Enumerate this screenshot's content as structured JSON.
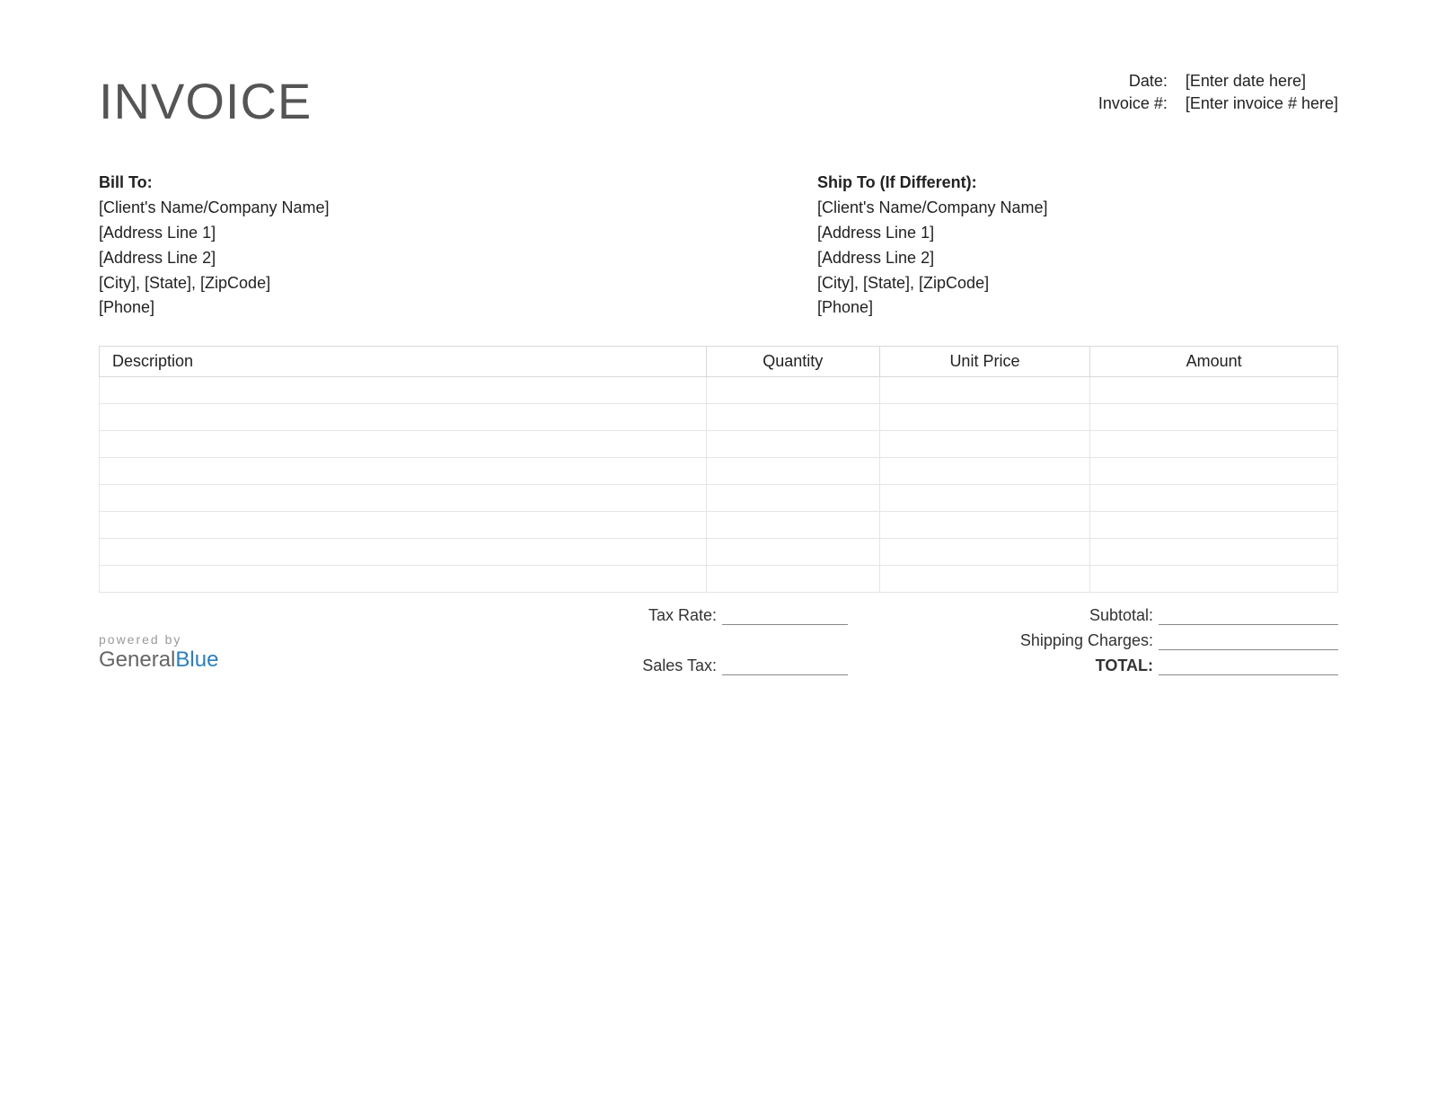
{
  "title": "INVOICE",
  "meta": {
    "date_label": "Date:",
    "date_value": "[Enter date here]",
    "invoice_num_label": "Invoice #:",
    "invoice_num_value": "[Enter invoice # here]"
  },
  "bill_to": {
    "heading": "Bill To:",
    "line1": "[Client's Name/Company Name]",
    "line2": "[Address Line 1]",
    "line3": "[Address Line 2]",
    "line4": "[City], [State], [ZipCode]",
    "line5": "[Phone]"
  },
  "ship_to": {
    "heading": "Ship To (If Different):",
    "line1": "[Client's Name/Company Name]",
    "line2": "[Address Line 1]",
    "line3": "[Address Line 2]",
    "line4": "[City], [State], [ZipCode]",
    "line5": "[Phone]"
  },
  "table": {
    "headers": {
      "description": "Description",
      "quantity": "Quantity",
      "unit_price": "Unit Price",
      "amount": "Amount"
    },
    "row_count": 8
  },
  "totals": {
    "tax_rate_label": "Tax Rate:",
    "sales_tax_label": "Sales Tax:",
    "subtotal_label": "Subtotal:",
    "shipping_label": "Shipping Charges:",
    "total_label": "TOTAL:"
  },
  "footer": {
    "powered_by": "powered by",
    "brand_part1": "General",
    "brand_part2": "Blue"
  }
}
